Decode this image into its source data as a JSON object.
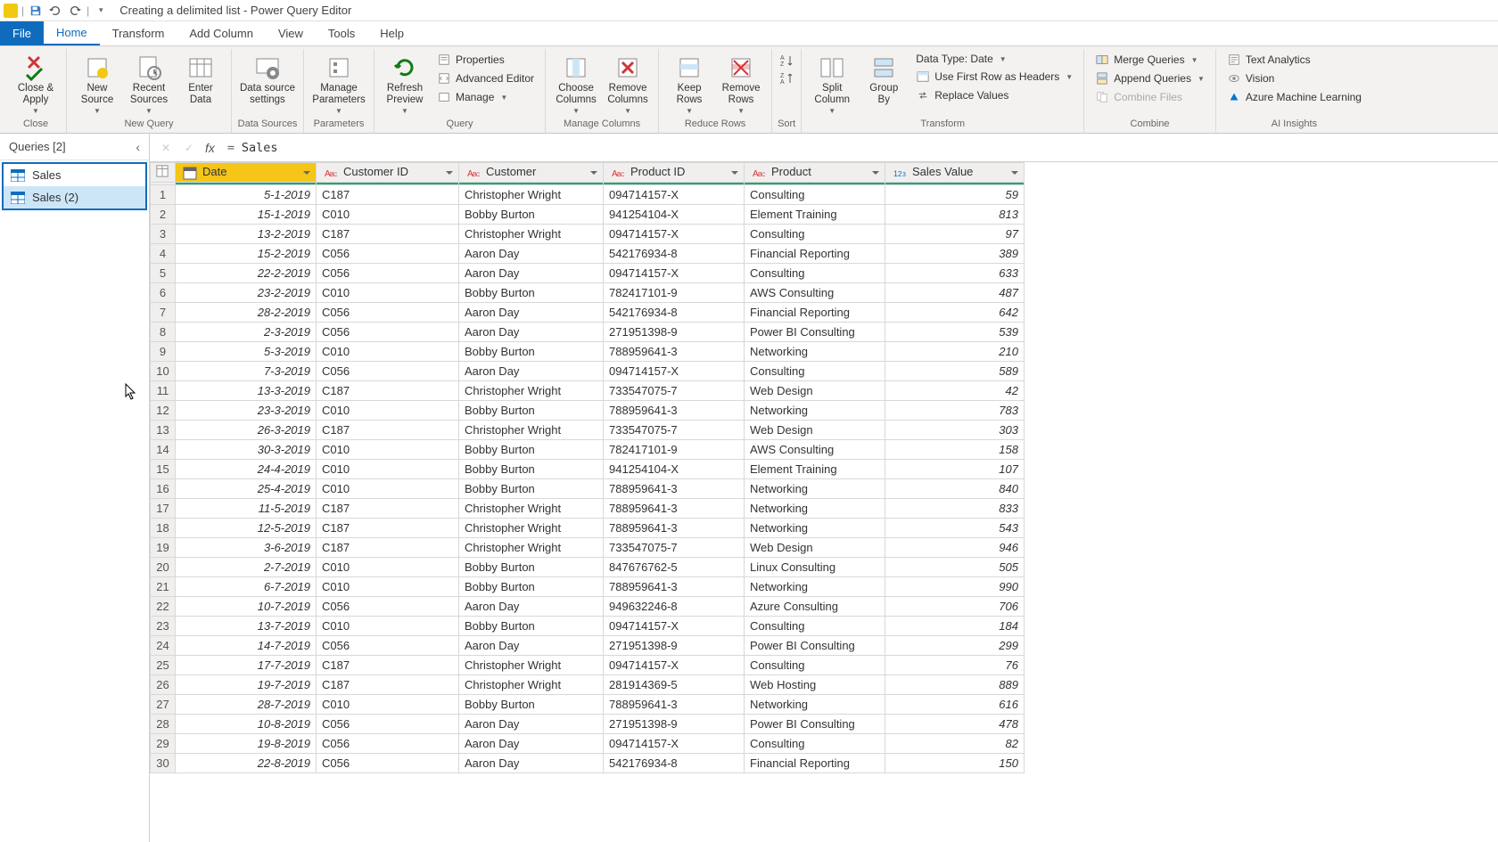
{
  "title": "Creating a delimited list - Power Query Editor",
  "menu": {
    "file": "File",
    "home": "Home",
    "transform": "Transform",
    "addColumn": "Add Column",
    "view": "View",
    "tools": "Tools",
    "help": "Help"
  },
  "ribbon": {
    "close": {
      "closeApply": "Close &\nApply",
      "group": "Close"
    },
    "newQuery": {
      "newSource": "New\nSource",
      "recentSources": "Recent\nSources",
      "enterData": "Enter\nData",
      "group": "New Query"
    },
    "dataSources": {
      "settings": "Data source\nsettings",
      "group": "Data Sources"
    },
    "parameters": {
      "manage": "Manage\nParameters",
      "group": "Parameters"
    },
    "query": {
      "refresh": "Refresh\nPreview",
      "properties": "Properties",
      "advEditor": "Advanced Editor",
      "manage": "Manage",
      "group": "Query"
    },
    "manageCols": {
      "choose": "Choose\nColumns",
      "remove": "Remove\nColumns",
      "group": "Manage Columns"
    },
    "reduceRows": {
      "keep": "Keep\nRows",
      "remove": "Remove\nRows",
      "group": "Reduce Rows"
    },
    "sort": {
      "group": "Sort"
    },
    "transform": {
      "split": "Split\nColumn",
      "groupBy": "Group\nBy",
      "dataType": "Data Type: Date",
      "firstRow": "Use First Row as Headers",
      "replace": "Replace Values",
      "group": "Transform"
    },
    "combine": {
      "merge": "Merge Queries",
      "append": "Append Queries",
      "combineFiles": "Combine Files",
      "group": "Combine"
    },
    "ai": {
      "textAnalytics": "Text Analytics",
      "vision": "Vision",
      "azureML": "Azure Machine Learning",
      "group": "AI Insights"
    }
  },
  "queriesPane": {
    "header": "Queries [2]",
    "items": [
      "Sales",
      "Sales (2)"
    ]
  },
  "formula": "Sales",
  "columns": [
    "Date",
    "Customer ID",
    "Customer",
    "Product ID",
    "Product",
    "Sales Value"
  ],
  "rows": [
    {
      "n": 1,
      "date": "5-1-2019",
      "cid": "C187",
      "cust": "Christopher Wright",
      "pid": "094714157-X",
      "prod": "Consulting",
      "val": 59
    },
    {
      "n": 2,
      "date": "15-1-2019",
      "cid": "C010",
      "cust": "Bobby Burton",
      "pid": "941254104-X",
      "prod": "Element Training",
      "val": 813
    },
    {
      "n": 3,
      "date": "13-2-2019",
      "cid": "C187",
      "cust": "Christopher Wright",
      "pid": "094714157-X",
      "prod": "Consulting",
      "val": 97
    },
    {
      "n": 4,
      "date": "15-2-2019",
      "cid": "C056",
      "cust": "Aaron Day",
      "pid": "542176934-8",
      "prod": "Financial Reporting",
      "val": 389
    },
    {
      "n": 5,
      "date": "22-2-2019",
      "cid": "C056",
      "cust": "Aaron Day",
      "pid": "094714157-X",
      "prod": "Consulting",
      "val": 633
    },
    {
      "n": 6,
      "date": "23-2-2019",
      "cid": "C010",
      "cust": "Bobby Burton",
      "pid": "782417101-9",
      "prod": "AWS Consulting",
      "val": 487
    },
    {
      "n": 7,
      "date": "28-2-2019",
      "cid": "C056",
      "cust": "Aaron Day",
      "pid": "542176934-8",
      "prod": "Financial Reporting",
      "val": 642
    },
    {
      "n": 8,
      "date": "2-3-2019",
      "cid": "C056",
      "cust": "Aaron Day",
      "pid": "271951398-9",
      "prod": "Power BI Consulting",
      "val": 539
    },
    {
      "n": 9,
      "date": "5-3-2019",
      "cid": "C010",
      "cust": "Bobby Burton",
      "pid": "788959641-3",
      "prod": "Networking",
      "val": 210
    },
    {
      "n": 10,
      "date": "7-3-2019",
      "cid": "C056",
      "cust": "Aaron Day",
      "pid": "094714157-X",
      "prod": "Consulting",
      "val": 589
    },
    {
      "n": 11,
      "date": "13-3-2019",
      "cid": "C187",
      "cust": "Christopher Wright",
      "pid": "733547075-7",
      "prod": "Web Design",
      "val": 42
    },
    {
      "n": 12,
      "date": "23-3-2019",
      "cid": "C010",
      "cust": "Bobby Burton",
      "pid": "788959641-3",
      "prod": "Networking",
      "val": 783
    },
    {
      "n": 13,
      "date": "26-3-2019",
      "cid": "C187",
      "cust": "Christopher Wright",
      "pid": "733547075-7",
      "prod": "Web Design",
      "val": 303
    },
    {
      "n": 14,
      "date": "30-3-2019",
      "cid": "C010",
      "cust": "Bobby Burton",
      "pid": "782417101-9",
      "prod": "AWS Consulting",
      "val": 158
    },
    {
      "n": 15,
      "date": "24-4-2019",
      "cid": "C010",
      "cust": "Bobby Burton",
      "pid": "941254104-X",
      "prod": "Element Training",
      "val": 107
    },
    {
      "n": 16,
      "date": "25-4-2019",
      "cid": "C010",
      "cust": "Bobby Burton",
      "pid": "788959641-3",
      "prod": "Networking",
      "val": 840
    },
    {
      "n": 17,
      "date": "11-5-2019",
      "cid": "C187",
      "cust": "Christopher Wright",
      "pid": "788959641-3",
      "prod": "Networking",
      "val": 833
    },
    {
      "n": 18,
      "date": "12-5-2019",
      "cid": "C187",
      "cust": "Christopher Wright",
      "pid": "788959641-3",
      "prod": "Networking",
      "val": 543
    },
    {
      "n": 19,
      "date": "3-6-2019",
      "cid": "C187",
      "cust": "Christopher Wright",
      "pid": "733547075-7",
      "prod": "Web Design",
      "val": 946
    },
    {
      "n": 20,
      "date": "2-7-2019",
      "cid": "C010",
      "cust": "Bobby Burton",
      "pid": "847676762-5",
      "prod": "Linux Consulting",
      "val": 505
    },
    {
      "n": 21,
      "date": "6-7-2019",
      "cid": "C010",
      "cust": "Bobby Burton",
      "pid": "788959641-3",
      "prod": "Networking",
      "val": 990
    },
    {
      "n": 22,
      "date": "10-7-2019",
      "cid": "C056",
      "cust": "Aaron Day",
      "pid": "949632246-8",
      "prod": "Azure Consulting",
      "val": 706
    },
    {
      "n": 23,
      "date": "13-7-2019",
      "cid": "C010",
      "cust": "Bobby Burton",
      "pid": "094714157-X",
      "prod": "Consulting",
      "val": 184
    },
    {
      "n": 24,
      "date": "14-7-2019",
      "cid": "C056",
      "cust": "Aaron Day",
      "pid": "271951398-9",
      "prod": "Power BI Consulting",
      "val": 299
    },
    {
      "n": 25,
      "date": "17-7-2019",
      "cid": "C187",
      "cust": "Christopher Wright",
      "pid": "094714157-X",
      "prod": "Consulting",
      "val": 76
    },
    {
      "n": 26,
      "date": "19-7-2019",
      "cid": "C187",
      "cust": "Christopher Wright",
      "pid": "281914369-5",
      "prod": "Web Hosting",
      "val": 889
    },
    {
      "n": 27,
      "date": "28-7-2019",
      "cid": "C010",
      "cust": "Bobby Burton",
      "pid": "788959641-3",
      "prod": "Networking",
      "val": 616
    },
    {
      "n": 28,
      "date": "10-8-2019",
      "cid": "C056",
      "cust": "Aaron Day",
      "pid": "271951398-9",
      "prod": "Power BI Consulting",
      "val": 478
    },
    {
      "n": 29,
      "date": "19-8-2019",
      "cid": "C056",
      "cust": "Aaron Day",
      "pid": "094714157-X",
      "prod": "Consulting",
      "val": 82
    },
    {
      "n": 30,
      "date": "22-8-2019",
      "cid": "C056",
      "cust": "Aaron Day",
      "pid": "542176934-8",
      "prod": "Financial Reporting",
      "val": 150
    }
  ]
}
